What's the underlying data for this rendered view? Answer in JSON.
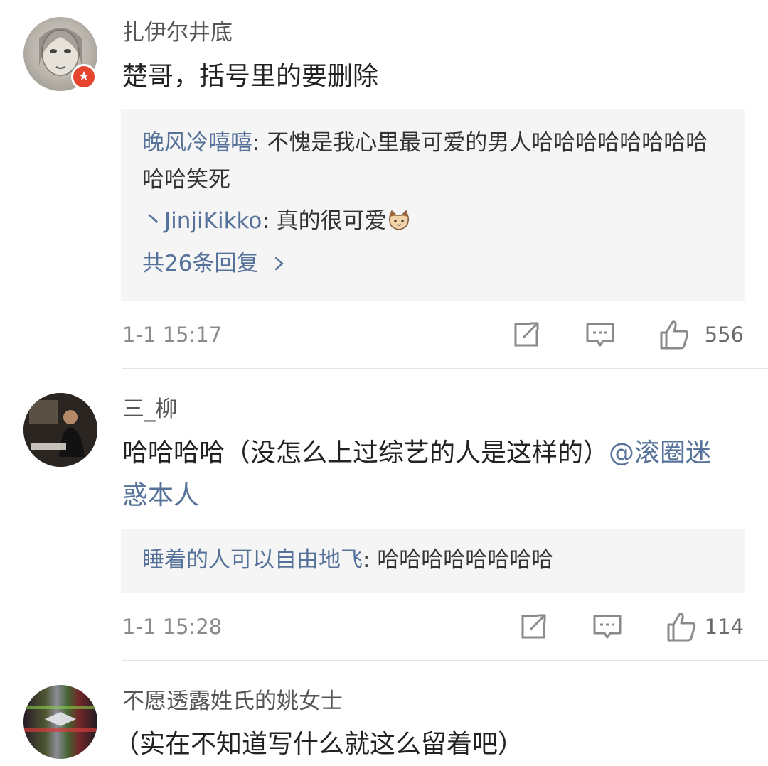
{
  "comments": [
    {
      "username": "扎伊尔井底",
      "text": "楚哥，括号里的要删除",
      "replies": [
        {
          "user": "晚风冷嘻嘻",
          "text": "不愧是我心里最可爱的男人哈哈哈哈哈哈哈哈哈哈笑死"
        },
        {
          "user": "丶JinjiKikko",
          "text": "真的很可爱"
        }
      ],
      "reply_count": "共26条回复",
      "time": "1-1 15:17",
      "likes": "556"
    },
    {
      "username": "三_柳",
      "text": "哈哈哈哈（没怎么上过综艺的人是这样的）",
      "mention": "@滚圈迷惑本人",
      "replies": [
        {
          "user": "睡着的人可以自由地飞",
          "text": "哈哈哈哈哈哈哈哈"
        }
      ],
      "time": "1-1 15:28",
      "likes": "114"
    },
    {
      "username": "不愿透露姓氏的姚女士",
      "text": "（实在不知道写什么就这么留着吧）"
    }
  ],
  "icons": {
    "share": "share-icon",
    "comment": "comment-icon",
    "like": "thumbs-up-icon",
    "chevron": "chevron-right-icon",
    "badge": "verified-badge-icon",
    "emoji": "cat-emoji-icon"
  },
  "colors": {
    "link": "#56729a",
    "badge": "#e5452f",
    "reply_bg": "#f5f5f5"
  }
}
